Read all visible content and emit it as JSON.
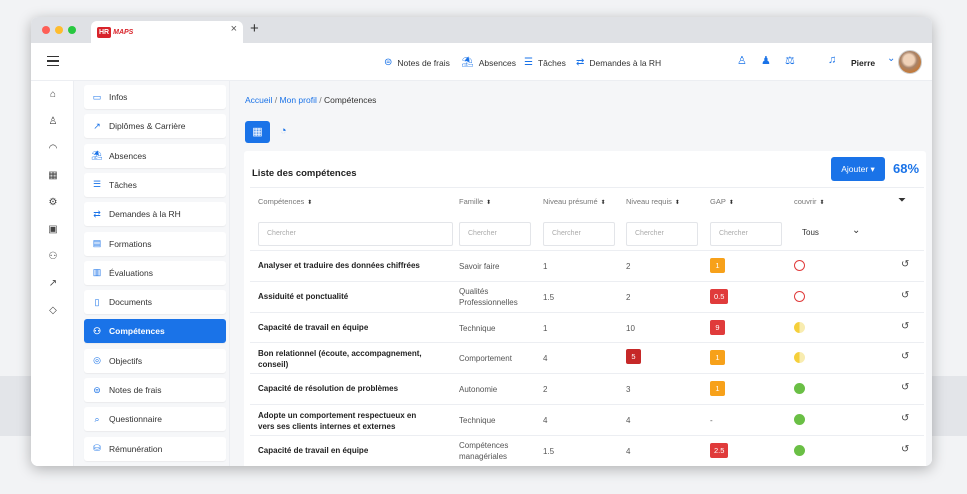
{
  "browser": {
    "tab_close": "×",
    "new_tab": "+"
  },
  "logo": {
    "hr": "HR",
    "maps": "MAPS"
  },
  "topnav": [
    {
      "icon": "receipt-icon",
      "glyph": "⊜",
      "label": "Notes de frais"
    },
    {
      "icon": "beach-umbrella-icon",
      "glyph": "⛱",
      "label": "Absences"
    },
    {
      "icon": "tasks-list-icon",
      "glyph": "☰",
      "label": "Tâches"
    },
    {
      "icon": "transfer-icon",
      "glyph": "⇄",
      "label": "Demandes à la RH"
    }
  ],
  "user": {
    "name": "Pierre"
  },
  "sidebar": [
    {
      "name": "infos",
      "glyph": "▭",
      "label": "Infos"
    },
    {
      "name": "diplomes",
      "glyph": "↗",
      "label": "Diplômes & Carrière"
    },
    {
      "name": "absences",
      "glyph": "⛱",
      "label": "Absences"
    },
    {
      "name": "taches",
      "glyph": "☰",
      "label": "Tâches"
    },
    {
      "name": "demandes",
      "glyph": "⇄",
      "label": "Demandes à la RH"
    },
    {
      "name": "formations",
      "glyph": "▤",
      "label": "Formations"
    },
    {
      "name": "evaluations",
      "glyph": "▥",
      "label": "Évaluations"
    },
    {
      "name": "documents",
      "glyph": "▯",
      "label": "Documents"
    },
    {
      "name": "competences",
      "glyph": "⚇",
      "label": "Compétences",
      "active": true
    },
    {
      "name": "objectifs",
      "glyph": "◎",
      "label": "Objectifs"
    },
    {
      "name": "notes-de-frais",
      "glyph": "⊜",
      "label": "Notes de frais"
    },
    {
      "name": "questionnaire",
      "glyph": "⌕",
      "label": "Questionnaire"
    },
    {
      "name": "remuneration",
      "glyph": "⛁",
      "label": "Rémunération"
    }
  ],
  "breadcrumb": {
    "home": "Accueil",
    "profile": "Mon profil",
    "current": "Compétences",
    "sep": "/"
  },
  "card": {
    "title": "Liste des compétences",
    "add_label": "Ajouter ▾",
    "percent": "68%"
  },
  "table": {
    "headers": [
      "Compétences",
      "Famille",
      "Niveau présumé",
      "Niveau requis",
      "GAP",
      "couvrir"
    ],
    "sort_glyph": "⬍",
    "placeholder": "Chercher",
    "select_value": "Tous",
    "rows": [
      {
        "comp": "Analyser et traduire des données chiffrées",
        "fam": "Savoir faire",
        "pres": "1",
        "req": "2",
        "gap": "1",
        "gapColor": "#f7a11a",
        "redReq": false,
        "cover": "empty"
      },
      {
        "comp": "Assiduité et ponctualité",
        "fam": "Qualités Professionnelles",
        "pres": "1.5",
        "req": "2",
        "gap": "0.5",
        "gapColor": "#e03b3b",
        "redReq": false,
        "cover": "empty"
      },
      {
        "comp": "Capacité de travail en équipe",
        "fam": "Technique",
        "pres": "1",
        "req": "10",
        "gap": "9",
        "gapColor": "#e03b3b",
        "redReq": false,
        "cover": "half"
      },
      {
        "comp": "Bon relationnel (écoute, accompagnement, conseil)",
        "fam": "Comportement",
        "pres": "4",
        "req": "5",
        "gap": "1",
        "gapColor": "#f7a11a",
        "redReq": true,
        "cover": "half"
      },
      {
        "comp": "Capacité de résolution de problèmes",
        "fam": "Autonomie",
        "pres": "2",
        "req": "3",
        "gap": "1",
        "gapColor": "#f7a11a",
        "redReq": false,
        "cover": "full"
      },
      {
        "comp": "Adopte un comportement respectueux en vers ses clients internes et externes",
        "fam": "Technique",
        "pres": "4",
        "req": "4",
        "gap": "-",
        "gapColor": "",
        "redReq": false,
        "cover": "full"
      },
      {
        "comp": "Capacité de travail en équipe",
        "fam": "Compétences managériales",
        "pres": "1.5",
        "req": "4",
        "gap": "2.5",
        "gapColor": "#e03b3b",
        "redReq": false,
        "cover": "full"
      }
    ]
  },
  "colors": {
    "accent": "#1a73e8",
    "red": "#e03b3b",
    "orange": "#f7a11a",
    "green": "#6abf45",
    "yellow": "#f5cf3a"
  }
}
